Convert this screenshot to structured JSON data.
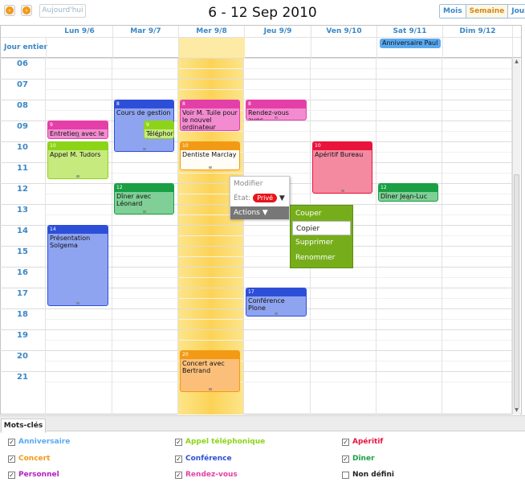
{
  "toolbar": {
    "today_label": "Aujourd'hui",
    "title": "6 - 12 Sep 2010",
    "views": [
      "Mois",
      "Semaine",
      "Jour"
    ],
    "active_view": "Semaine"
  },
  "days": [
    "Lun 9/6",
    "Mar 9/7",
    "Mer 9/8",
    "Jeu 9/9",
    "Ven 9/10",
    "Sat 9/11",
    "Dim 9/12"
  ],
  "allday_label": "Jour entier",
  "allday_events": [
    {
      "day": 5,
      "title": "Anniversaire Paul",
      "color": "#5aa9f0"
    }
  ],
  "hours": [
    "06",
    "07",
    "08",
    "09",
    "10",
    "11",
    "12",
    "13",
    "14",
    "15",
    "16",
    "17",
    "18",
    "19",
    "20",
    "21"
  ],
  "events": [
    {
      "day": 0,
      "start": 9.0,
      "end": 9.9,
      "hour": "9",
      "title": "Entretien avec le ...",
      "color": "#e43fa8",
      "bg": "#f28bd0"
    },
    {
      "day": 0,
      "start": 10.0,
      "end": 11.8,
      "hour": "10",
      "title": "Appel M. Tudors",
      "color": "#8dd318",
      "bg": "#c6ea7e"
    },
    {
      "day": 0,
      "start": 14.0,
      "end": 17.9,
      "hour": "14",
      "title": "Présentation Solgema",
      "color": "#2d4fd8",
      "bg": "#8fa4f0"
    },
    {
      "day": 1,
      "start": 8.0,
      "end": 10.5,
      "hour": "8",
      "title": "Cours de gestion",
      "color": "#2d4fd8",
      "bg": "#8fa4f0"
    },
    {
      "day": 1,
      "start": 9.0,
      "end": 9.9,
      "hour": "9",
      "title": "Téléphone à M...",
      "color": "#8dd318",
      "bg": "#c6ea7e",
      "half": true
    },
    {
      "day": 1,
      "start": 12.0,
      "end": 13.5,
      "hour": "12",
      "title": "Dîner avec Léonard",
      "color": "#19a045",
      "bg": "#7fcf96"
    },
    {
      "day": 2,
      "start": 8.0,
      "end": 9.5,
      "hour": "8",
      "title": "Voir M. Tuile pour le nouvel ordinateur",
      "color": "#e43fa8",
      "bg": "#f28bd0"
    },
    {
      "day": 2,
      "start": 10.0,
      "end": 11.4,
      "hour": "10",
      "title": "Dentiste Marclay",
      "color": "#f39a14",
      "bg": "#fffdf5"
    },
    {
      "day": 2,
      "start": 20.0,
      "end": 22.0,
      "hour": "20",
      "title": "Concert avec Bertrand",
      "color": "#f39a14",
      "bg": "#fbbf7a"
    },
    {
      "day": 3,
      "start": 8.0,
      "end": 9.0,
      "hour": "8",
      "title": "Rendez-vous avec ...",
      "color": "#e43fa8",
      "bg": "#f28bd0"
    },
    {
      "day": 3,
      "start": 17.0,
      "end": 18.4,
      "hour": "17",
      "title": "Conférence Plone",
      "color": "#2d4fd8",
      "bg": "#8fa4f0"
    },
    {
      "day": 4,
      "start": 10.0,
      "end": 12.5,
      "hour": "10",
      "title": "Apéritif Bureau",
      "color": "#e8143c",
      "bg": "#f48aa0"
    },
    {
      "day": 5,
      "start": 12.0,
      "end": 12.9,
      "hour": "12",
      "title": "Dîner Jean-Luc",
      "color": "#19a045",
      "bg": "#7fcf96"
    }
  ],
  "context_menu": {
    "modify": "Modifier",
    "state_label": "État",
    "state_value": "Privé",
    "actions": "Actions ▼"
  },
  "actions_menu": [
    "Couper",
    "Copier",
    "Supprimer",
    "Renommer"
  ],
  "actions_selected": "Copier",
  "tags_tab": "Mots-clés",
  "tags": [
    {
      "label": "Anniversaire",
      "color": "#5aa9f0",
      "checked": true
    },
    {
      "label": "Appel téléphonique",
      "color": "#8dd318",
      "checked": true
    },
    {
      "label": "Apéritif",
      "color": "#e8143c",
      "checked": true
    },
    {
      "label": "Concert",
      "color": "#f39a14",
      "checked": true
    },
    {
      "label": "Conférence",
      "color": "#2d4fd8",
      "checked": true
    },
    {
      "label": "Dîner",
      "color": "#19a045",
      "checked": true
    },
    {
      "label": "Personnel",
      "color": "#b020c0",
      "checked": true
    },
    {
      "label": "Rendez-vous",
      "color": "#e43fa8",
      "checked": true
    },
    {
      "label": "Non défini",
      "color": "#222222",
      "checked": false
    }
  ]
}
